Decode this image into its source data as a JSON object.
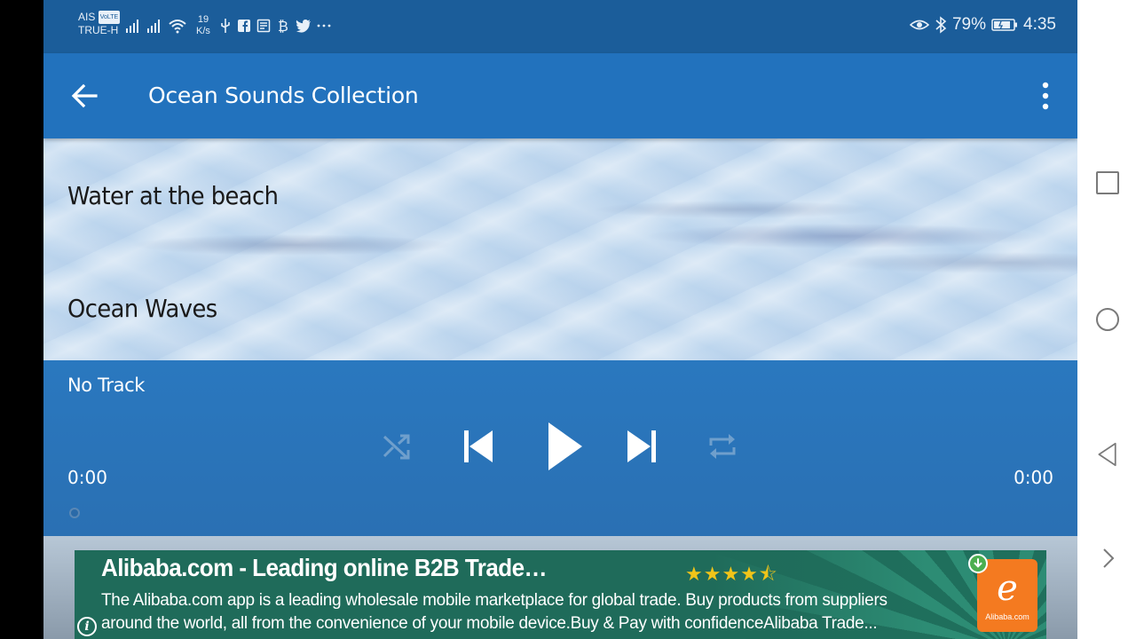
{
  "status_bar": {
    "carrier_top": "AIS",
    "volte": "VoLTE",
    "carrier_bottom": "TRUE-H",
    "speed_value": "19",
    "speed_unit": "K/s",
    "battery": "79%",
    "time": "4:35"
  },
  "toolbar": {
    "title": "Ocean Sounds Collection"
  },
  "tracks": [
    {
      "label": "Water at the beach"
    },
    {
      "label": "Ocean Waves"
    }
  ],
  "player": {
    "now_playing": "No Track",
    "elapsed": "0:00",
    "total": "0:00",
    "progress": 0
  },
  "ad": {
    "title": "Alibaba.com - Leading online B2B Trade…",
    "rating": "★★★★⯪",
    "description": "The Alibaba.com app is a leading wholesale mobile marketplace for global trade. Buy products from suppliers around the world, all from the convenience of your mobile device.Buy & Pay with confidenceAlibaba Trade...",
    "info": "i"
  },
  "colors": {
    "status_bar": "#1b5d9a",
    "toolbar": "#2272bd",
    "player": "#2a74b8",
    "ad_green": "#1f6b5a",
    "alibaba_orange": "#f47a20"
  }
}
